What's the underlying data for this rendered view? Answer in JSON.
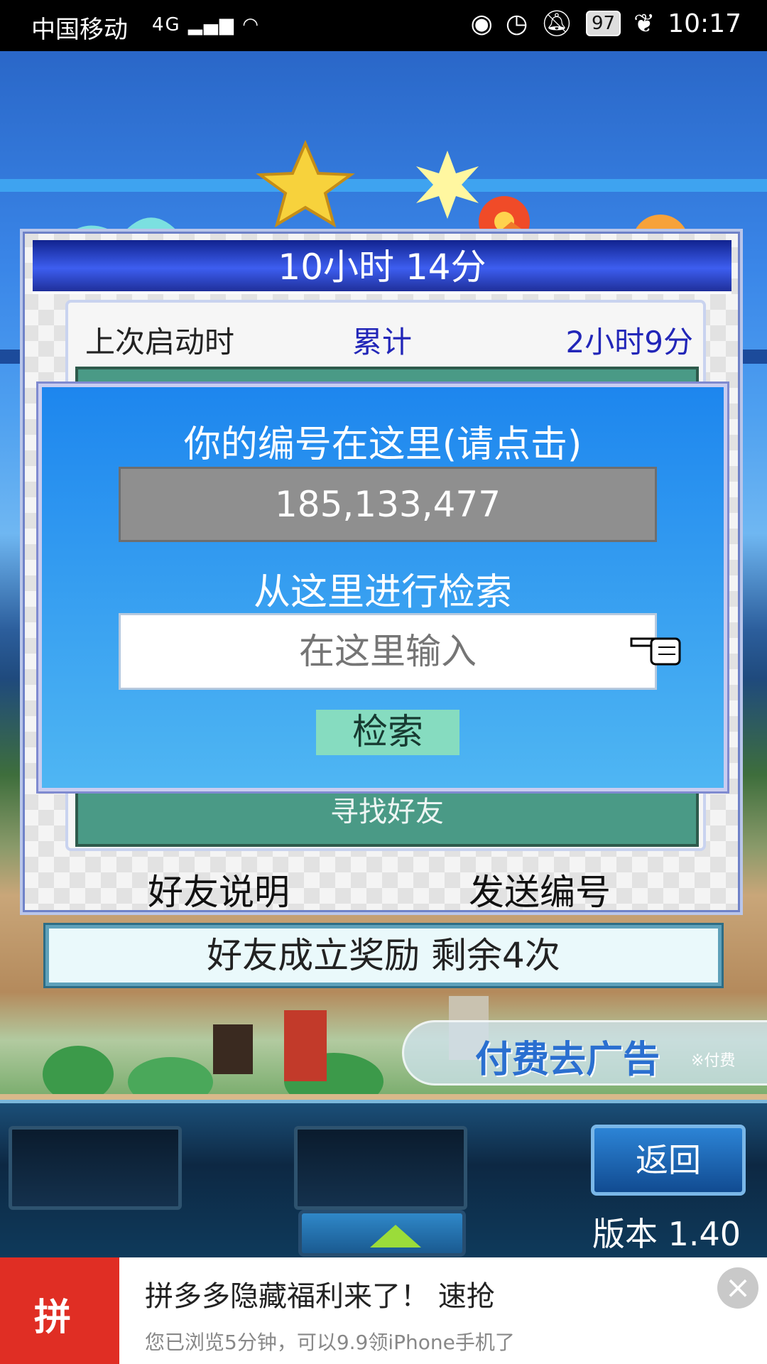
{
  "status_bar": {
    "carrier": "中国移动",
    "network": "4G",
    "battery": "97",
    "time": "10:17"
  },
  "dialog": {
    "title": "10小时 14分",
    "last_launch_label": "上次启动时",
    "total_label": "累计",
    "total_value": "2小时9分",
    "find_friend_partial": "寻找好友",
    "friend_help_button": "好友说明",
    "send_id_button": "发送编号"
  },
  "popup": {
    "your_id_label": "你的编号在这里(请点击)",
    "your_id_value": "185,133,477",
    "search_label": "从这里进行检索",
    "search_placeholder": "在这里输入",
    "search_button": "检索"
  },
  "reward_banner": "好友成立奖励  剩余4次",
  "remove_ads": {
    "label": "付费去广告",
    "note": "※付费"
  },
  "controls": {
    "back_button": "返回",
    "version": "版本 1.40"
  },
  "ad_banner": {
    "logo_text": "拼",
    "title": "拼多多隐藏福利来了！ 速抢",
    "subtitle": "您已浏览5分钟，可以9.9领iPhone手机了"
  },
  "colors": {
    "dialog_title_bg": "#1f2f9a",
    "popup_bg": "#1d86ee",
    "id_box_bg": "#8f8f8f",
    "search_button_bg": "#86dcc0",
    "accent_text": "#2226b8",
    "ad_logo_bg": "#e02e24"
  }
}
